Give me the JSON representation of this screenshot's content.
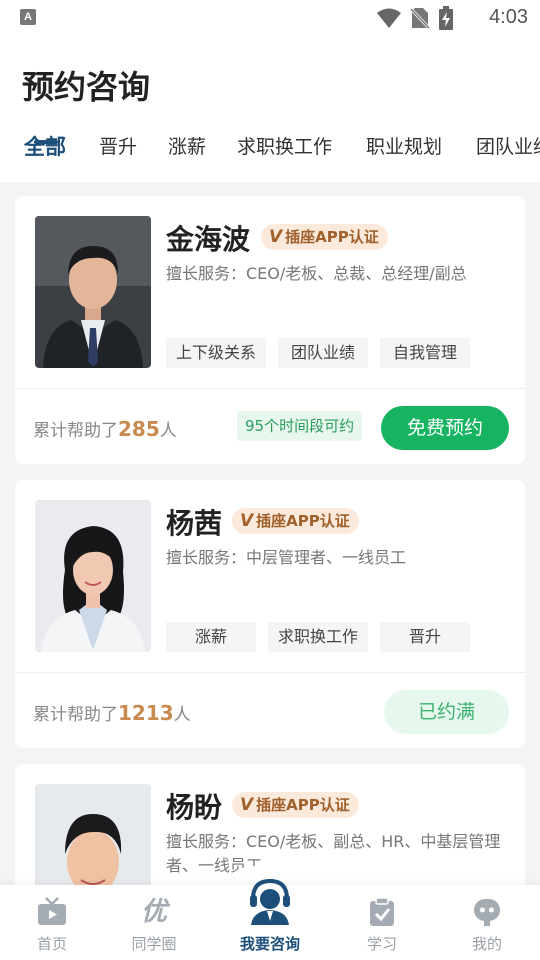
{
  "status_bar": {
    "left_icon_letter": "A",
    "time": "4:03"
  },
  "header": {
    "title": "预约咨询"
  },
  "tabs": [
    {
      "label": "全部",
      "active": true
    },
    {
      "label": "晋升"
    },
    {
      "label": "涨薪"
    },
    {
      "label": "求职换工作"
    },
    {
      "label": "职业规划"
    },
    {
      "label": "团队业绩"
    }
  ],
  "consultants": [
    {
      "name": "金海波",
      "badge_v": "V",
      "badge_text": "插座APP认证",
      "service": "擅长服务：CEO/老板、总裁、总经理/副总",
      "tags": [
        "上下级关系",
        "团队业绩",
        "自我管理"
      ],
      "helped_prefix": "累计帮助了",
      "helped_count": "285",
      "helped_suffix": "人",
      "slots": "95个时间段可约",
      "action": "免费预约"
    },
    {
      "name": "杨茜",
      "badge_v": "V",
      "badge_text": "插座APP认证",
      "service": "擅长服务：中层管理者、一线员工",
      "tags": [
        "涨薪",
        "求职换工作",
        "晋升"
      ],
      "helped_prefix": "累计帮助了",
      "helped_count": "1213",
      "helped_suffix": "人",
      "action": "已约满"
    },
    {
      "name": "杨盼",
      "badge_v": "V",
      "badge_text": "插座APP认证",
      "service": "擅长服务：CEO/老板、副总、HR、中基层管理者、一线员工"
    }
  ],
  "bottom_nav": [
    {
      "label": "首页",
      "icon": "tv-icon"
    },
    {
      "label": "同学圈",
      "icon": "you-char-icon",
      "glyph": "优"
    },
    {
      "label": "我要咨询",
      "icon": "consultant-headset-icon",
      "active": true
    },
    {
      "label": "学习",
      "icon": "clipboard-check-icon"
    },
    {
      "label": "我的",
      "icon": "robot-face-icon"
    }
  ],
  "colors": {
    "accent": "#1d4f7a",
    "book_green": "#16b460",
    "badge_bg": "#fbeadb",
    "badge_text": "#a0612c",
    "count_orange": "#c98a4f"
  }
}
